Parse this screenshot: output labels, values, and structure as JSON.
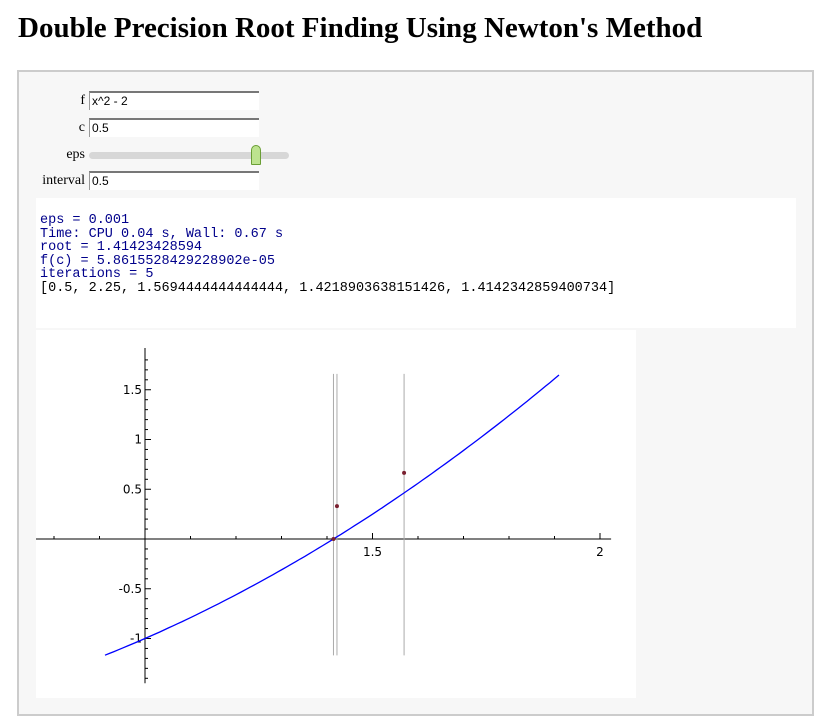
{
  "title": "Double Precision Root Finding Using Newton's Method",
  "controls": {
    "f": {
      "label": "f",
      "value": "x^2 - 2"
    },
    "c": {
      "label": "c",
      "value": "0.5"
    },
    "eps": {
      "label": "eps",
      "slider_fraction": 0.85
    },
    "interval": {
      "label": "interval",
      "value": "0.5"
    }
  },
  "output": {
    "lines": [
      "eps = 0.001",
      "Time: CPU 0.04 s, Wall: 0.67 s",
      "root = 1.41423428594",
      "f(c) = 5.8615528429228902e-05",
      "iterations = 5"
    ],
    "list": "[0.5, 2.25, 1.5694444444444444, 1.4218903638151426, 1.4142342859400734]"
  },
  "chart_data": {
    "type": "line",
    "function": "x^2 - 2",
    "xlim": [
      0.75,
      2.02
    ],
    "ylim": [
      -1.45,
      1.95
    ],
    "x_ticks": [
      "1.5",
      "2"
    ],
    "y_ticks": [
      "-1",
      "-0.5",
      "0.5",
      "1",
      "1.5"
    ],
    "curve_x_range": [
      0.912,
      1.91
    ],
    "vertical_lines": [
      1.4142,
      1.4219,
      1.5694
    ],
    "vertical_line_range": [
      -1.17,
      1.66
    ],
    "points": [
      [
        1.4142,
        0
      ],
      [
        1.4219,
        0.33
      ],
      [
        1.5694,
        0.665
      ]
    ],
    "colors": {
      "curve": "#0000ff",
      "points": "#7a2030",
      "lines": "#aaaaaa"
    }
  }
}
